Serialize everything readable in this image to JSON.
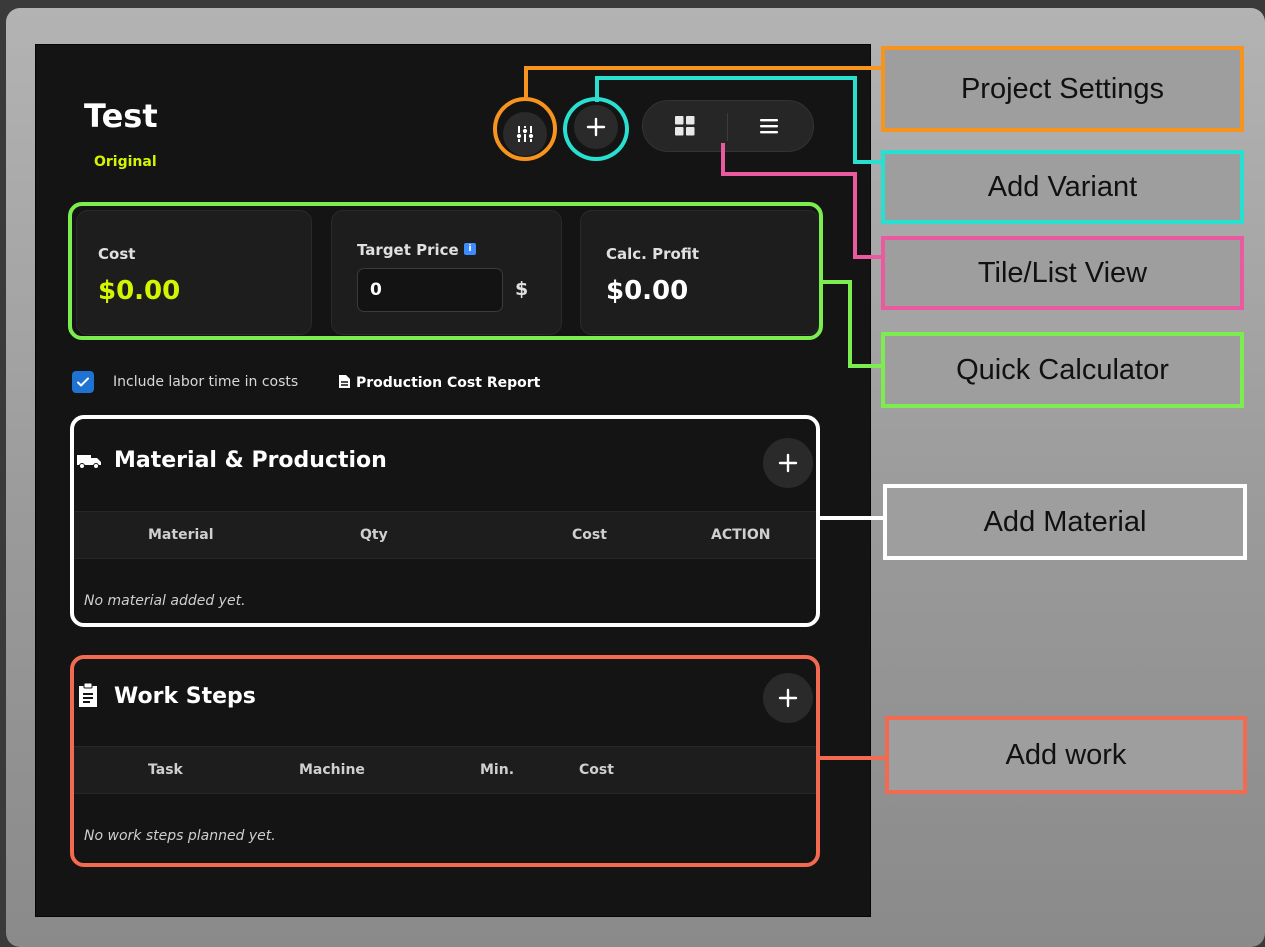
{
  "project": {
    "title": "Test",
    "variant": "Original"
  },
  "toolbar": {
    "settings_icon": "sliders-icon",
    "add_variant_icon": "plus-icon",
    "tile_view_icon": "grid-icon",
    "list_view_icon": "list-icon"
  },
  "quick_calculator": {
    "cost_label": "Cost",
    "cost_value": "$0.00",
    "target_price_label": "Target Price",
    "target_price_value": "0",
    "currency": "$",
    "profit_label": "Calc. Profit",
    "profit_value": "$0.00"
  },
  "options": {
    "include_labor_label": "Include labor time in costs",
    "include_labor_checked": true,
    "report_label": "Production Cost Report"
  },
  "material_section": {
    "title": "Material & Production",
    "columns": [
      "Material",
      "Qty",
      "Cost",
      "ACTION"
    ],
    "empty_text": "No material added yet."
  },
  "work_section": {
    "title": "Work Steps",
    "columns": [
      "Task",
      "Machine",
      "Min.",
      "Cost"
    ],
    "empty_text": "No work steps planned yet."
  },
  "annotations": [
    {
      "label": "Project Settings",
      "color": "#f7941d"
    },
    {
      "label": "Add Variant",
      "color": "#29e0d0"
    },
    {
      "label": "Tile/List View",
      "color": "#ea5aa0"
    },
    {
      "label": "Quick Calculator",
      "color": "#7cec4f"
    },
    {
      "label": "Add Material",
      "color": "#ffffff"
    },
    {
      "label": "Add work",
      "color": "#f26a4f"
    }
  ],
  "colors": {
    "accent_yellow": "#d4f500",
    "checkbox_blue": "#1e73d2",
    "info_blue": "#3d8bfd"
  }
}
